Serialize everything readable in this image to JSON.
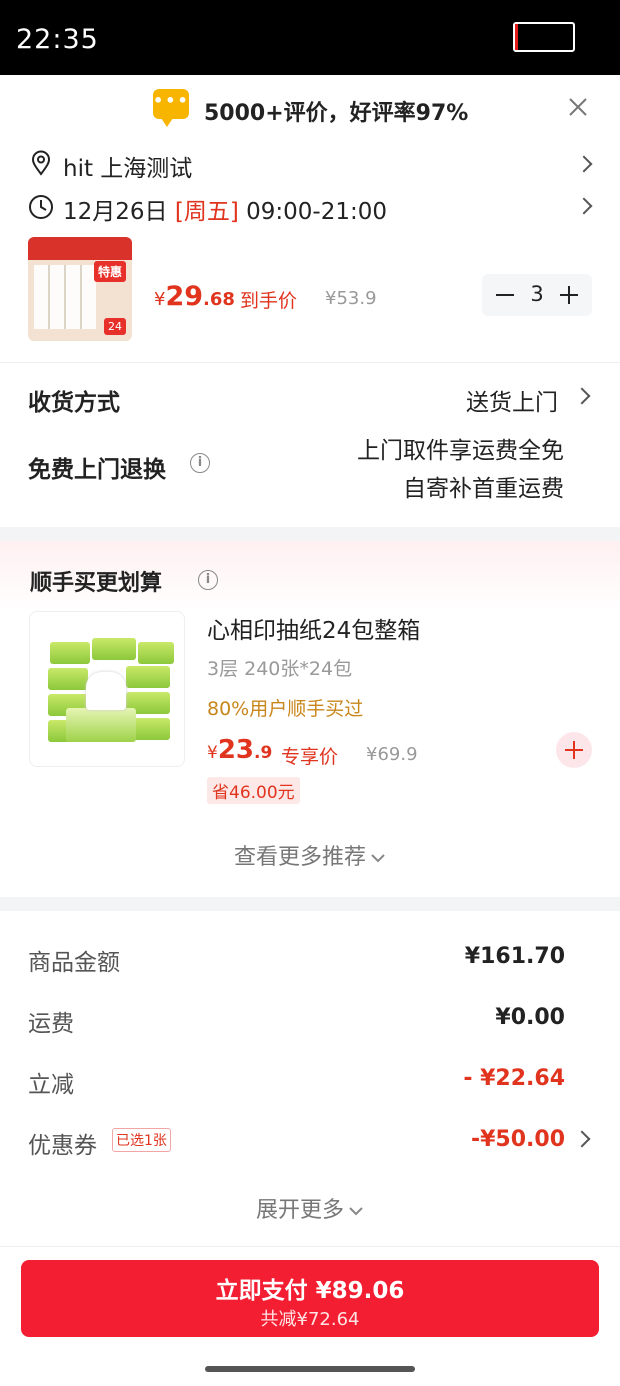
{
  "status": {
    "time": "22:35"
  },
  "banner": {
    "text": "5000+评价，好评率97%"
  },
  "address": {
    "text": "hit  上海测试"
  },
  "delivery_time": {
    "date": "12月26日",
    "weekday": "[周五]",
    "hours": "09:00-21:00"
  },
  "product": {
    "price_symbol": "¥",
    "price_int": "29",
    "price_dec": ".68",
    "price_label": "到手价",
    "original_price": "¥53.9",
    "quantity": "3"
  },
  "shipping": {
    "label": "收货方式",
    "value": "送货上门"
  },
  "return": {
    "label": "免费上门退换",
    "line1": "上门取件享运费全免",
    "line2": "自寄补首重运费"
  },
  "recommend": {
    "title": "顺手买更划算",
    "name": "心相印抽纸24包整箱",
    "spec": "3层 240张*24包",
    "social": "80%用户顺手买过",
    "price_symbol": "¥",
    "price_int": "23",
    "price_dec": ".9",
    "price_label": "专享价",
    "original_price": "¥69.9",
    "save": "省46.00元",
    "more": "查看更多推荐"
  },
  "fees": {
    "goods_label": "商品金额",
    "goods_value": "¥161.70",
    "freight_label": "运费",
    "freight_value": "¥0.00",
    "discount_label": "立减",
    "discount_value": "- ¥22.64",
    "coupon_label": "优惠券",
    "coupon_badge": "已选1张",
    "coupon_value": "-¥50.00",
    "expand": "展开更多"
  },
  "pay": {
    "main": "立即支付 ¥89.06",
    "sub": "共减¥72.64"
  },
  "colors": {
    "accent": "#e0341e",
    "button": "#f41e33"
  }
}
